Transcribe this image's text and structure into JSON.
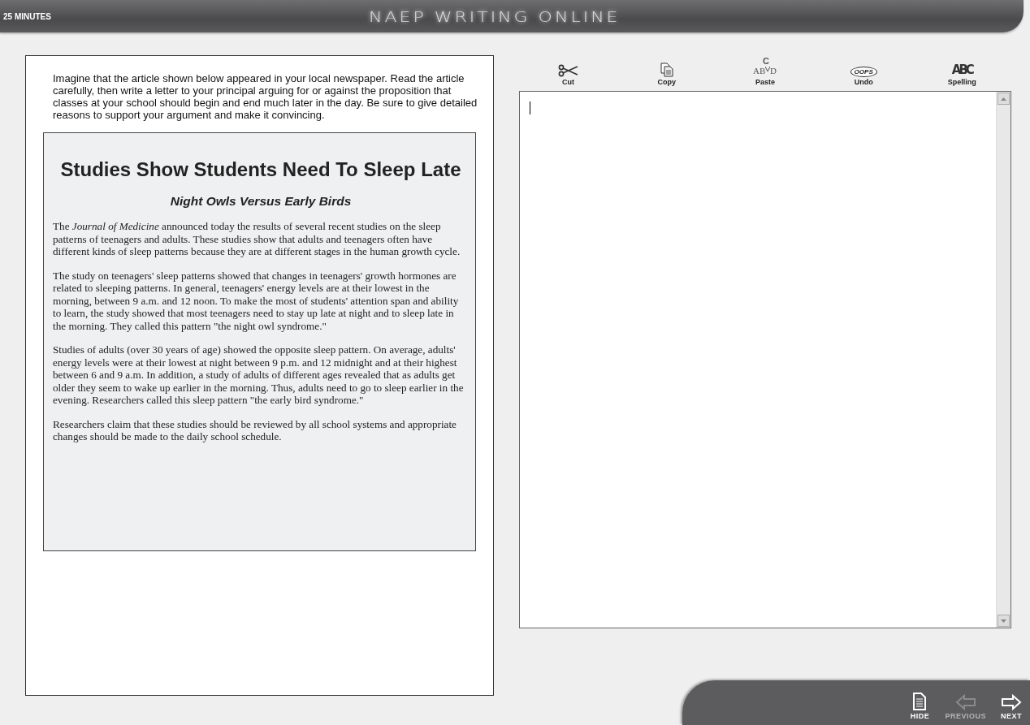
{
  "header": {
    "timer": "25 MINUTES",
    "title": "NAEP WRITING ONLINE"
  },
  "prompt": "Imagine that the article shown below appeared in your local newspaper. Read the article carefully, then write a letter to your principal arguing for or against the proposition that classes at your school should begin and end much later in the day. Be sure to give detailed reasons to support your argument and make it convincing.",
  "article": {
    "headline": "Studies Show Students Need To Sleep Late",
    "subheadline": "Night Owls Versus Early Birds",
    "paragraphs": [
      "The *Journal of Medicine* announced today the results of several recent studies on the sleep patterns of teenagers and adults. These studies show that adults and teenagers often have different kinds of sleep patterns because they are at different stages in the human growth cycle.",
      "The study on teenagers' sleep patterns showed that changes in teenagers' growth hormones are related to sleeping patterns. In general, teenagers' energy levels are at their lowest in the morning, between 9 a.m. and 12 noon. To make the most of students' attention span and ability to learn, the study showed that most teenagers need to stay up late at night and to sleep late in the morning. They called this pattern \"the night owl syndrome.\"",
      "Studies of adults (over 30 years of age) showed the opposite sleep pattern. On average, adults' energy levels were at their lowest at night between 9 p.m. and 12 midnight and at their highest between 6 and 9 a.m. In addition, a study of adults of different ages revealed that as adults get older they seem to wake up earlier in the morning. Thus, adults need to go to sleep earlier in the evening. Researchers called this sleep pattern \"the early bird syndrome.\"",
      "Researchers claim that these studies should be reviewed by all school systems and appropriate changes should be made to the daily school schedule."
    ]
  },
  "toolbar": [
    {
      "kind": "cut",
      "label": "Cut"
    },
    {
      "kind": "copy",
      "label": "Copy"
    },
    {
      "kind": "paste",
      "label": "Paste",
      "icon_text": [
        "C",
        "AB",
        "D"
      ]
    },
    {
      "kind": "undo",
      "label": "Undo",
      "icon_text": [
        "OOPS"
      ]
    },
    {
      "kind": "spelling",
      "label": "Spelling",
      "icon_text": [
        "ABC"
      ]
    }
  ],
  "editor": {
    "focused": true
  },
  "nav": [
    {
      "kind": "hide",
      "label": "HIDE",
      "disabled": false
    },
    {
      "kind": "previous",
      "label": "PREVIOUS",
      "disabled": true
    },
    {
      "kind": "next",
      "label": "NEXT",
      "disabled": false
    }
  ]
}
